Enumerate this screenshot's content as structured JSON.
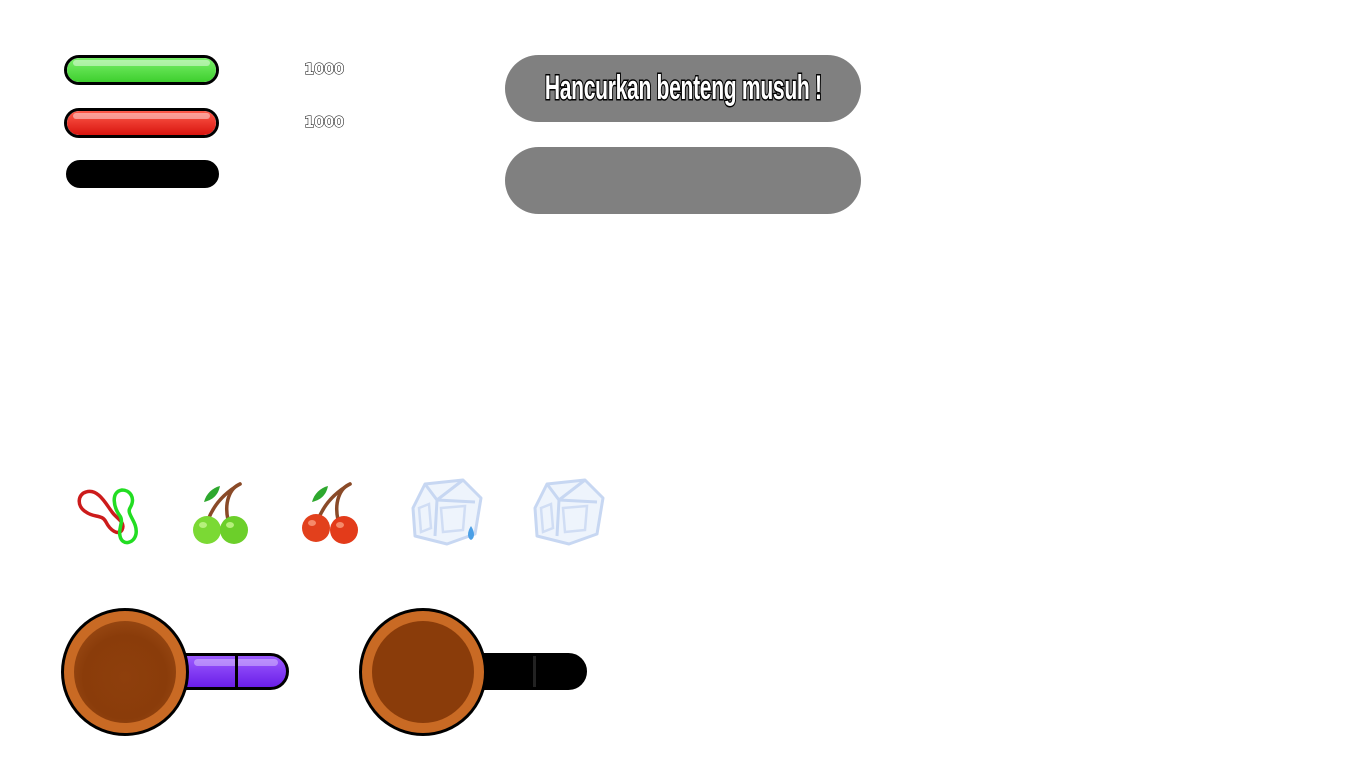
{
  "status_bars": {
    "green": {
      "value_text": "1000",
      "level": 1.0,
      "color": "#44dd33"
    },
    "red": {
      "value_text": "1000",
      "level": 1.0,
      "color": "#e8201a"
    },
    "black": {
      "level": 0.0,
      "color": "#000000"
    }
  },
  "mission": {
    "objective": "Hancurkan benteng musuh !",
    "secondary": ""
  },
  "items": [
    {
      "name": "rubber-band-icon"
    },
    {
      "name": "green-cherry-icon"
    },
    {
      "name": "red-cherry-icon"
    },
    {
      "name": "ice-cube-melting-icon"
    },
    {
      "name": "ice-cube-icon"
    }
  ],
  "skills": [
    {
      "name": "skill-1",
      "gauge_color": "#7a2ef0",
      "gauge_level": 1.0
    },
    {
      "name": "skill-2",
      "gauge_color": "#000000",
      "gauge_level": 0.0
    }
  ],
  "colors": {
    "panel": "#808080",
    "wheel_ring": "#c96a24",
    "wheel_center": "#8a3c0a"
  }
}
